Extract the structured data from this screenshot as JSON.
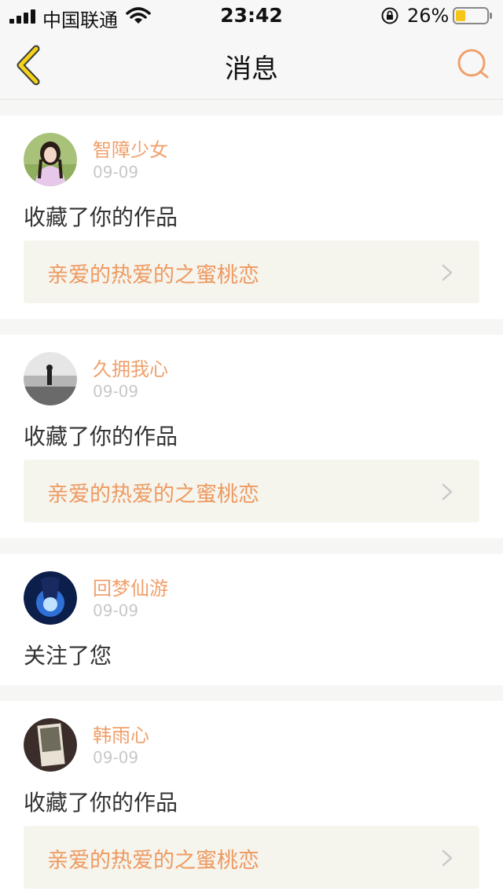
{
  "status_bar": {
    "carrier": "中国联通",
    "time": "23:42",
    "battery": "26%",
    "battery_level": 0.26
  },
  "nav": {
    "title": "消息"
  },
  "colors": {
    "accent": "#f0a06c",
    "link_bg": "#f5f5ee",
    "back_arrow": "#f2d21a"
  },
  "messages": [
    {
      "user": "智障少女",
      "date": "09-09",
      "action": "收藏了你的作品",
      "work": "亲爱的热爱的之蜜桃恋"
    },
    {
      "user": "久拥我心",
      "date": "09-09",
      "action": "收藏了你的作品",
      "work": "亲爱的热爱的之蜜桃恋"
    },
    {
      "user": "回梦仙游",
      "date": "09-09",
      "action": "关注了您"
    },
    {
      "user": "韩雨心",
      "date": "09-09",
      "action": "收藏了你的作品",
      "work": "亲爱的热爱的之蜜桃恋"
    }
  ]
}
